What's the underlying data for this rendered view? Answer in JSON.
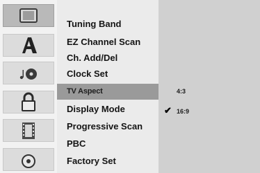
{
  "sidebar": {
    "icons": [
      {
        "name": "tv-icon",
        "active": true
      },
      {
        "name": "letter-a-icon",
        "active": false
      },
      {
        "name": "music-disc-icon",
        "active": false
      },
      {
        "name": "lock-icon",
        "active": false
      },
      {
        "name": "film-icon",
        "active": false
      },
      {
        "name": "disc-icon",
        "active": false
      }
    ]
  },
  "menu": {
    "items": [
      "Tuning Band",
      "EZ Channel Scan",
      "Ch. Add/Del",
      "Clock Set",
      "TV Aspect",
      "Display Mode",
      "Progressive Scan",
      "PBC",
      "Factory Set"
    ],
    "highlighted_index": 4
  },
  "options": {
    "items": [
      "4:3",
      "16:9"
    ],
    "selected_index": 1,
    "check_mark": "✔"
  },
  "colors": {
    "highlight": "#9a9a9a",
    "options_panel": "#d0d0d0"
  }
}
